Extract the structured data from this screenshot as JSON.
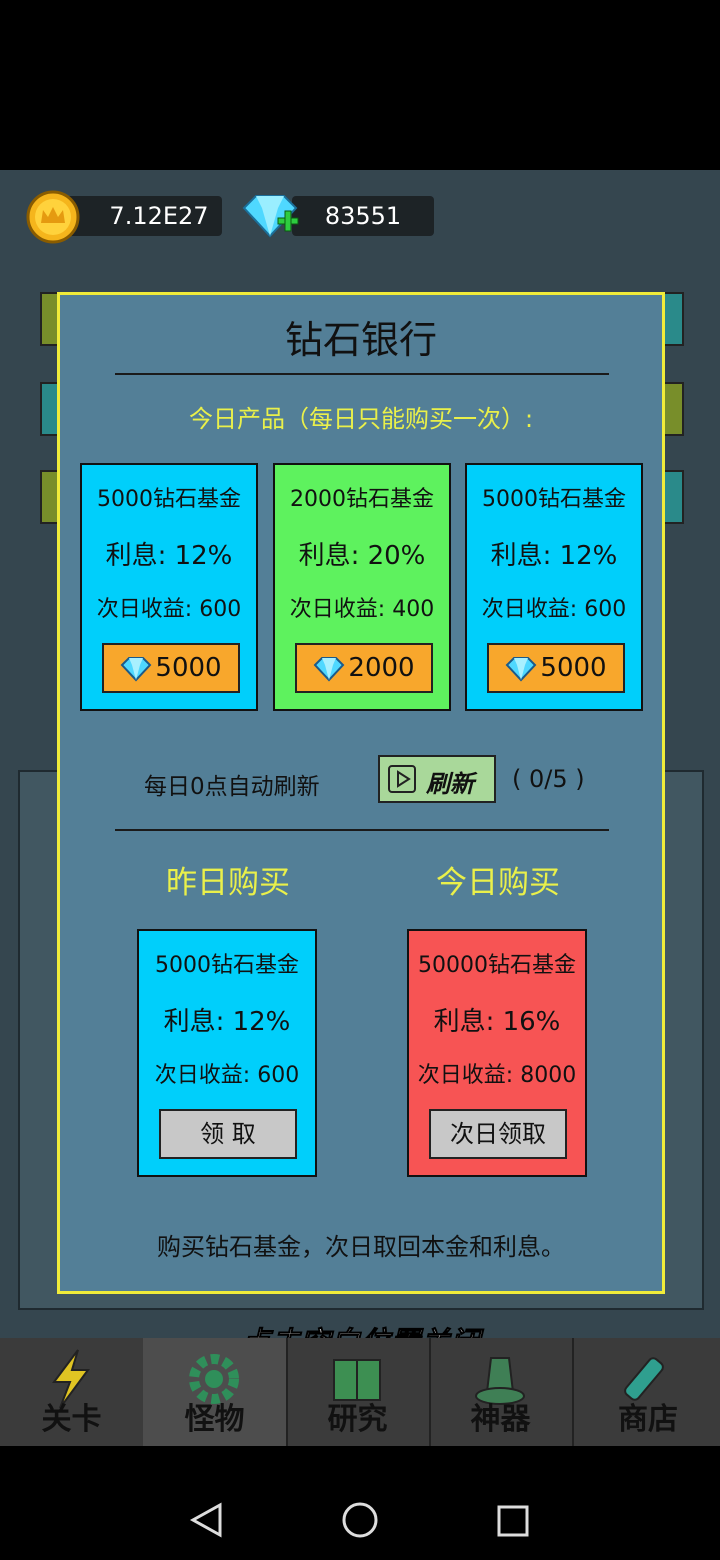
{
  "resources": {
    "gold": "7.12E27",
    "diamonds": "83551"
  },
  "dialog": {
    "title": "钻石银行",
    "today_products_label": "今日产品（每日只能购买一次）:",
    "products": [
      {
        "name": "5000钻石基金",
        "interest": "利息: 12%",
        "next_day": "次日收益: 600",
        "price": "5000",
        "color": "#00cffb"
      },
      {
        "name": "2000钻石基金",
        "interest": "利息: 20%",
        "next_day": "次日收益: 400",
        "price": "2000",
        "color": "#5ef25e"
      },
      {
        "name": "5000钻石基金",
        "interest": "利息: 12%",
        "next_day": "次日收益: 600",
        "price": "5000",
        "color": "#00cffb"
      }
    ],
    "refresh_note": "每日0点自动刷新",
    "refresh_button": "刷新",
    "refresh_count": "( 0/5 )",
    "yesterday_label": "昨日购买",
    "today_label": "今日购买",
    "yesterday_card": {
      "name": "5000钻石基金",
      "interest": "利息: 12%",
      "next_day": "次日收益: 600",
      "button": "领 取",
      "color": "#00cffb"
    },
    "today_card": {
      "name": "50000钻石基金",
      "interest": "利息: 16%",
      "next_day": "次日收益: 8000",
      "button": "次日领取",
      "color": "#f75454"
    },
    "footer_note": "购买钻石基金，次日取回本金和利息。"
  },
  "close_hint": "点击空白位置关闭",
  "nav": [
    {
      "label": "关卡"
    },
    {
      "label": "怪物"
    },
    {
      "label": "研究"
    },
    {
      "label": "神器"
    },
    {
      "label": "商店"
    }
  ]
}
